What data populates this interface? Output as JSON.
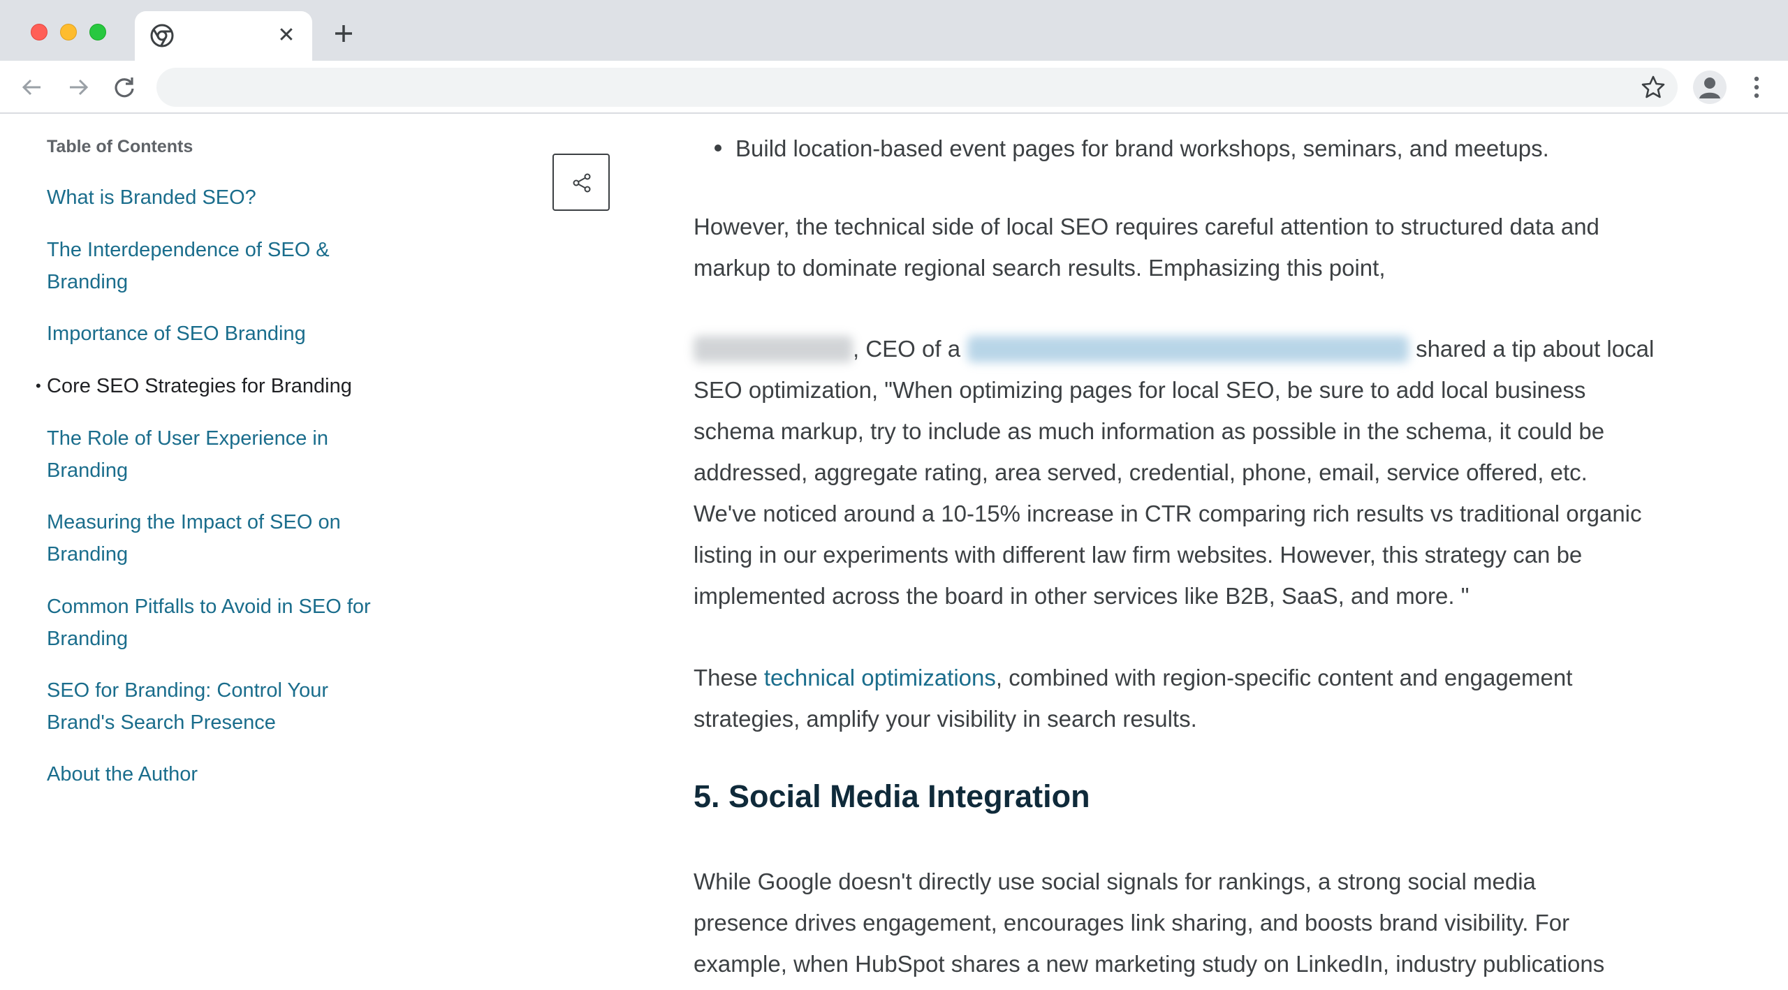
{
  "browser": {
    "tab_close": "✕",
    "address_placeholder": "",
    "icons": [
      "chrome-icon",
      "close-icon",
      "plus-icon",
      "back-icon",
      "forward-icon",
      "reload-icon",
      "star-icon",
      "profile-icon",
      "menu-icon"
    ]
  },
  "toc": {
    "title": "Table of Contents",
    "items": [
      {
        "line1": "What is Branded SEO?",
        "line2": ""
      },
      {
        "line1": "The Interdependence of SEO &",
        "line2": "Branding"
      },
      {
        "line1": "Importance of SEO Branding",
        "line2": ""
      },
      {
        "line1": "Core SEO Strategies for Branding",
        "line2": ""
      },
      {
        "line1": "The Role of User Experience in",
        "line2": "Branding"
      },
      {
        "line1": "Measuring the Impact of SEO on",
        "line2": "Branding"
      },
      {
        "line1": "Common Pitfalls to Avoid in SEO for",
        "line2": "Branding"
      },
      {
        "line1": "SEO for Branding: Control Your",
        "line2": "Brand's Search Presence"
      },
      {
        "line1": "About the Author",
        "line2": ""
      }
    ],
    "active_index": 3,
    "active_bullet": "•"
  },
  "article": {
    "bullet": "Build location-based event pages for brand workshops, seminars, and meetups.",
    "para1": [
      "However, the technical side of local SEO requires careful attention to structured data and",
      "markup to dominate regional search results. Emphasizing this point,"
    ],
    "quote_intro_mid": ", CEO of a",
    "quote_intro_end": "shared a tip about local",
    "quote_lines": [
      "SEO optimization, \"When optimizing pages for local SEO, be sure to add local business",
      "schema markup, try to include as much information as possible in the schema, it could be",
      "addressed, aggregate rating, area served, credential, phone, email, service offered, etc.",
      "We've noticed around a 10-15% increase in CTR comparing rich results vs traditional organic",
      "listing in our experiments with different law firm websites. However, this strategy can be",
      "implemented across the board in other services like B2B, SaaS, and more. \""
    ],
    "para3_start": "These",
    "para3_link": "technical optimizations",
    "para3_rest": ", combined with region-specific content and engagement",
    "para3_line2": "strategies, amplify your visibility in search results.",
    "heading": "5. Social Media Integration",
    "para4": [
      "While Google doesn't directly use social signals for rankings, a strong social media",
      "presence drives engagement, encourages link sharing, and boosts brand visibility. For",
      "example, when HubSpot shares a new marketing study on LinkedIn, industry publications"
    ]
  },
  "colors": {
    "link": "#1a6d8c",
    "text": "#3c4043",
    "heading": "#0f2a3a"
  }
}
